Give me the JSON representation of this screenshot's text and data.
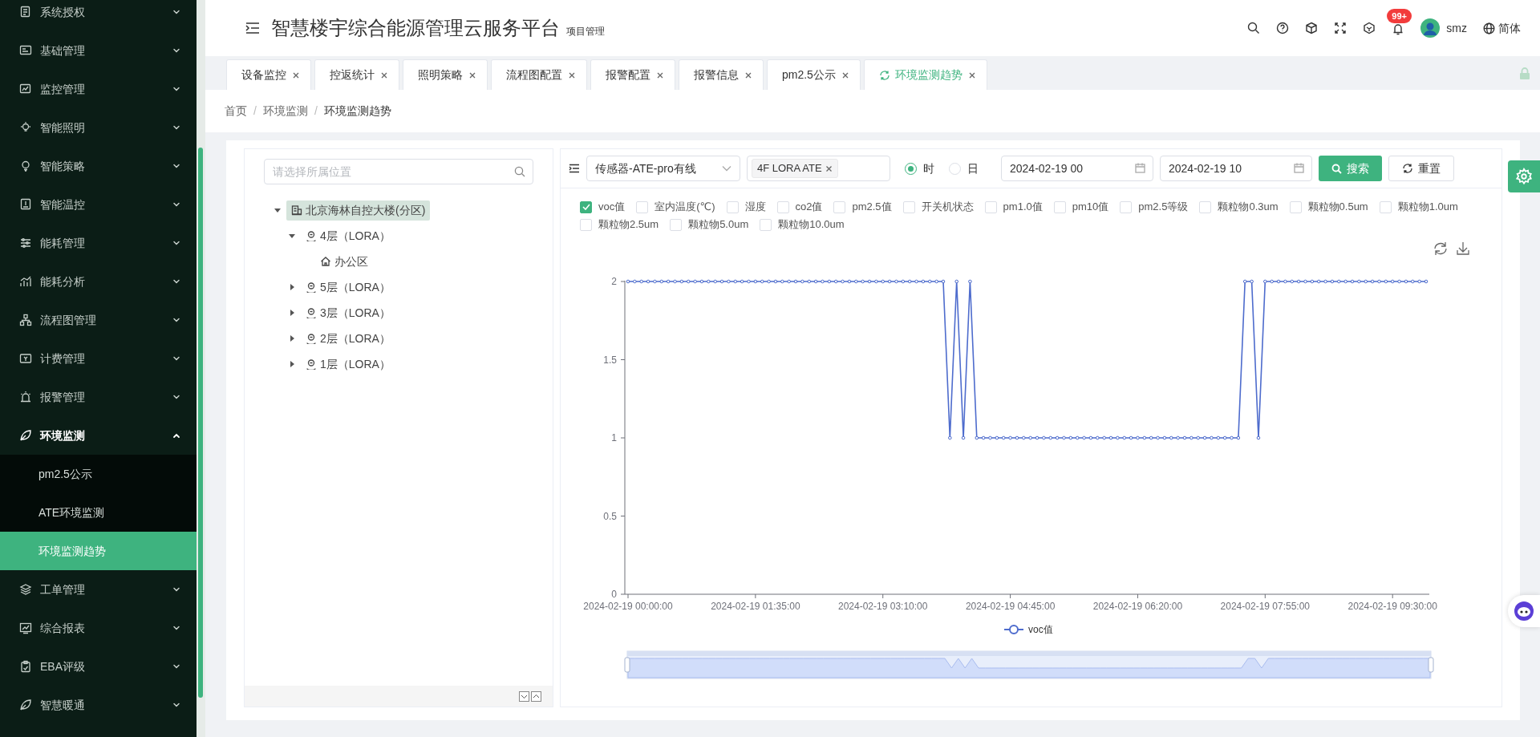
{
  "sidebar": {
    "items": [
      {
        "label": "系统授权",
        "expanded": false
      },
      {
        "label": "基础管理",
        "expanded": false
      },
      {
        "label": "监控管理",
        "expanded": false
      },
      {
        "label": "智能照明",
        "expanded": false
      },
      {
        "label": "智能策略",
        "expanded": false
      },
      {
        "label": "智能温控",
        "expanded": false
      },
      {
        "label": "能耗管理",
        "expanded": false
      },
      {
        "label": "能耗分析",
        "expanded": false
      },
      {
        "label": "流程图管理",
        "expanded": false
      },
      {
        "label": "计费管理",
        "expanded": false
      },
      {
        "label": "报警管理",
        "expanded": false
      },
      {
        "label": "环境监测",
        "expanded": true,
        "children": [
          {
            "label": "pm2.5公示",
            "selected": false
          },
          {
            "label": "ATE环境监测",
            "selected": false
          },
          {
            "label": "环境监测趋势",
            "selected": true
          }
        ]
      },
      {
        "label": "工单管理",
        "expanded": false
      },
      {
        "label": "综合报表",
        "expanded": false
      },
      {
        "label": "EBA评级",
        "expanded": false
      },
      {
        "label": "智慧暖通",
        "expanded": false
      }
    ]
  },
  "header": {
    "title": "智慧楼宇综合能源管理云服务平台",
    "subtitle": "项目管理",
    "notification_badge": "99+",
    "user": "smz",
    "language": "简体"
  },
  "tabs": [
    {
      "label": "设备监控",
      "selected": false
    },
    {
      "label": "控返统计",
      "selected": false
    },
    {
      "label": "照明策略",
      "selected": false
    },
    {
      "label": "流程图配置",
      "selected": false
    },
    {
      "label": "报警配置",
      "selected": false
    },
    {
      "label": "报警信息",
      "selected": false
    },
    {
      "label": "pm2.5公示",
      "selected": false
    },
    {
      "label": "环境监测趋势",
      "selected": true
    }
  ],
  "breadcrumb": {
    "separator": "/",
    "items": [
      "首页",
      "环境监测",
      "环境监测趋势"
    ]
  },
  "tree": {
    "search": {
      "placeholder": "请选择所属位置"
    },
    "nodes": [
      {
        "label": "北京海林自控大楼(分区)",
        "expanded": true,
        "selected": true,
        "children": [
          {
            "label": "4层（LORA）",
            "expanded": true,
            "selected": false,
            "children": [
              {
                "label": "办公区",
                "selected": false
              }
            ]
          },
          {
            "label": "5层（LORA）",
            "expanded": false,
            "selected": false
          },
          {
            "label": "3层（LORA）",
            "expanded": false,
            "selected": false
          },
          {
            "label": "2层（LORA）",
            "expanded": false,
            "selected": false
          },
          {
            "label": "1层（LORA）",
            "expanded": false,
            "selected": false
          }
        ]
      }
    ]
  },
  "filters": {
    "device": "传感器-ATE-pro有线",
    "tags": [
      "4F LORA ATE"
    ],
    "granularity": [
      {
        "label": "时",
        "selected": true
      },
      {
        "label": "日",
        "selected": false
      }
    ],
    "start": "2024-02-19 00",
    "end": "2024-02-19 10",
    "search_button": "搜索",
    "reset_button": "重置"
  },
  "metrics": [
    {
      "label": "voc值",
      "checked": true
    },
    {
      "label": "室内温度(℃)",
      "checked": false
    },
    {
      "label": "湿度",
      "checked": false
    },
    {
      "label": "co2值",
      "checked": false
    },
    {
      "label": "pm2.5值",
      "checked": false
    },
    {
      "label": "开关机状态",
      "checked": false
    },
    {
      "label": "pm1.0值",
      "checked": false
    },
    {
      "label": "pm10值",
      "checked": false
    },
    {
      "label": "pm2.5等级",
      "checked": false
    },
    {
      "label": "颗粒物0.3um",
      "checked": false
    },
    {
      "label": "颗粒物0.5um",
      "checked": false
    },
    {
      "label": "颗粒物1.0um",
      "checked": false
    },
    {
      "label": "颗粒物2.5um",
      "checked": false
    },
    {
      "label": "颗粒物5.0um",
      "checked": false
    },
    {
      "label": "颗粒物10.0um",
      "checked": false
    }
  ],
  "chart": {
    "chart_data": {
      "type": "line",
      "categories": [
        "2024-02-19 00:00:00",
        null,
        null,
        null,
        null,
        null,
        null,
        null,
        null,
        null,
        null,
        null,
        null,
        null,
        null,
        null,
        null,
        null,
        null,
        "2024-02-19 01:35:00",
        null,
        null,
        null,
        null,
        null,
        null,
        null,
        null,
        null,
        null,
        null,
        null,
        null,
        null,
        null,
        null,
        null,
        null,
        "2024-02-19 03:10:00",
        null,
        null,
        null,
        null,
        null,
        null,
        null,
        null,
        null,
        null,
        null,
        null,
        null,
        null,
        null,
        null,
        null,
        null,
        "2024-02-19 04:45:00",
        null,
        null,
        null,
        null,
        null,
        null,
        null,
        null,
        null,
        null,
        null,
        null,
        null,
        null,
        null,
        null,
        null,
        null,
        "2024-02-19 06:20:00",
        null,
        null,
        null,
        null,
        null,
        null,
        null,
        null,
        null,
        null,
        null,
        null,
        null,
        null,
        null,
        null,
        null,
        null,
        "2024-02-19 07:55:00",
        null,
        null,
        null,
        null,
        null,
        null,
        null,
        null,
        null,
        null,
        null,
        null,
        null,
        null,
        null,
        null,
        null,
        null,
        "2024-02-19 09:30:00",
        null,
        null,
        null,
        null,
        null
      ],
      "series": [
        {
          "name": "voc值",
          "color": "#4e6ccd",
          "marker": "circle",
          "values": [
            2,
            2,
            2,
            2,
            2,
            2,
            2,
            2,
            2,
            2,
            2,
            2,
            2,
            2,
            2,
            2,
            2,
            2,
            2,
            2,
            2,
            2,
            2,
            2,
            2,
            2,
            2,
            2,
            2,
            2,
            2,
            2,
            2,
            2,
            2,
            2,
            2,
            2,
            2,
            2,
            2,
            2,
            2,
            2,
            2,
            2,
            2,
            2,
            1,
            2,
            1,
            2,
            1,
            1,
            1,
            1,
            1,
            1,
            1,
            1,
            1,
            1,
            1,
            1,
            1,
            1,
            1,
            1,
            1,
            1,
            1,
            1,
            1,
            1,
            1,
            1,
            1,
            1,
            1,
            1,
            1,
            1,
            1,
            1,
            1,
            1,
            1,
            1,
            1,
            1,
            1,
            1,
            2,
            2,
            1,
            2,
            2,
            2,
            2,
            2,
            2,
            2,
            2,
            2,
            2,
            2,
            2,
            2,
            2,
            2,
            2,
            2,
            2,
            2,
            2,
            2,
            2,
            2,
            2,
            2
          ]
        }
      ],
      "ylim": [
        0,
        2
      ],
      "yticks": [
        0,
        0.5,
        1,
        1.5,
        2
      ]
    }
  }
}
